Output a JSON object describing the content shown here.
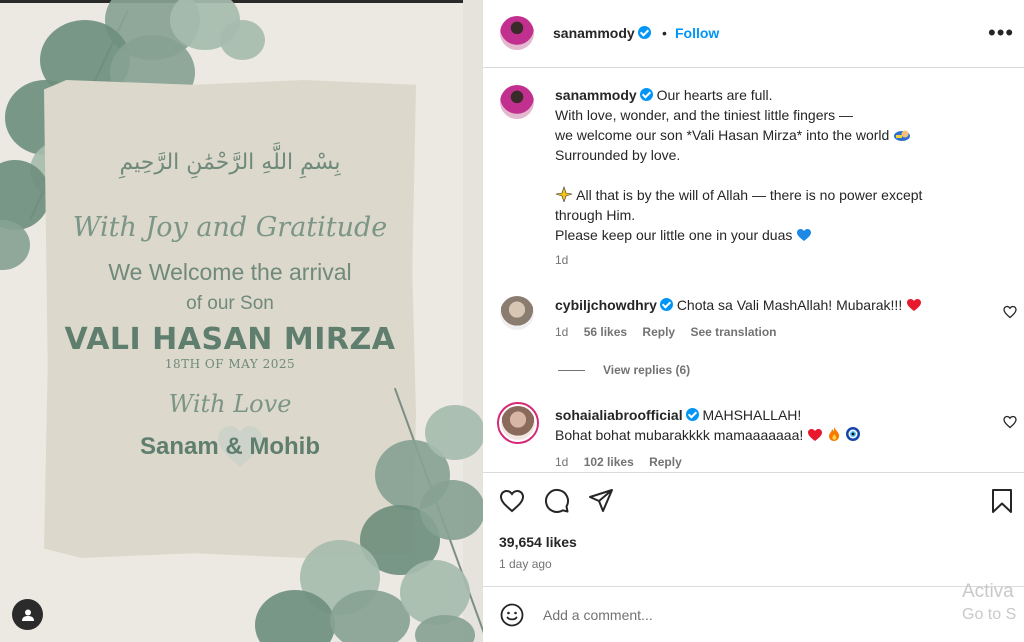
{
  "post_image": {
    "bismillah": "بِسْمِ اللَّهِ الرَّحْمَٰنِ الرَّحِيمِ",
    "heading_script": "With Joy and Gratitude",
    "line1": "We Welcome the arrival",
    "line2": "of our Son",
    "baby_name": "VALI HASAN MIRZA",
    "birth_date": "18TH OF MAY 2025",
    "with_love": "With Love",
    "parents": "Sanam & Mohib"
  },
  "header": {
    "username": "sanammody",
    "separator": "•",
    "follow_label": "Follow",
    "more_label": "•••"
  },
  "caption": {
    "username": "sanammody",
    "line1": "Our hearts are full.",
    "line2": "With love, wonder, and the tiniest little fingers —",
    "line3": "we welcome our son *Vali Hasan Mirza* into the world",
    "line4": "Surrounded by love.",
    "line5": "All that is by the will of Allah — there is no power except",
    "line6": "through Him.",
    "line7": "Please keep our little one in your duas",
    "time": "1d"
  },
  "comments": [
    {
      "username": "cybiljchowdhry",
      "text": "Chota sa Vali MashAllah! Mubarak!!!",
      "time": "1d",
      "likes": "56 likes",
      "reply_label": "Reply",
      "translate_label": "See translation",
      "view_replies": "View replies (6)"
    },
    {
      "username": "sohaialiabroofficial",
      "text_line1": "MAHSHALLAH!",
      "text_line2": "Bohat bohat mubarakkkk mamaaaaaaa!",
      "time": "1d",
      "likes": "102 likes",
      "reply_label": "Reply"
    }
  ],
  "footer": {
    "likes_count": "39,654 likes",
    "posted_ago": "1 day ago",
    "comment_placeholder": "Add a comment..."
  },
  "watermark": {
    "line1": "Activa",
    "line2": "Go to S"
  },
  "colors": {
    "accent": "#0095f6",
    "card_green": "#6f8a7b",
    "heart_red": "#e8192c"
  }
}
